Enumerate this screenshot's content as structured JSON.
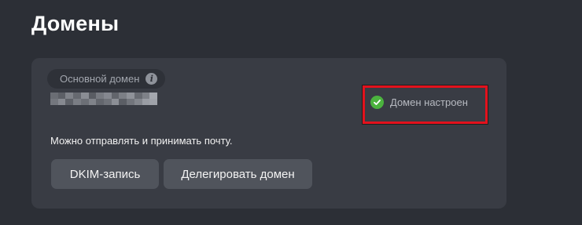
{
  "page": {
    "title": "Домены"
  },
  "domain_card": {
    "label": "Основной домен",
    "info_icon": "info-icon",
    "masked_domain_icon": "pixelated-redaction",
    "status": {
      "text": "Домен настроен",
      "icon": "check-circle-icon",
      "icon_color": "#4bb33e",
      "highlight_color": "#e3121d"
    },
    "description": "Можно отправлять и принимать почту.",
    "buttons": {
      "dkim": "DKIM-запись",
      "delegate": "Делегировать домен"
    }
  },
  "colors": {
    "background": "#2c2f36",
    "card": "#393c44",
    "button": "#50545c"
  }
}
